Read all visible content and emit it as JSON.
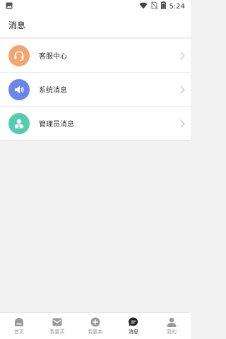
{
  "status_bar": {
    "time": "5:24"
  },
  "header": {
    "title": "消息"
  },
  "list": {
    "items": [
      {
        "label": "客服中心",
        "icon": "headset-icon",
        "color": "#f2a66e"
      },
      {
        "label": "系统消息",
        "icon": "speaker-icon",
        "color": "#6a86ee"
      },
      {
        "label": "管理员消息",
        "icon": "admin-user-icon",
        "color": "#54ccb0"
      }
    ]
  },
  "tabbar": {
    "tabs": [
      {
        "label": "首页",
        "icon": "home-icon",
        "active": false
      },
      {
        "label": "我要买",
        "icon": "mail-icon",
        "active": false
      },
      {
        "label": "我要卖",
        "icon": "plus-circle-icon",
        "active": false
      },
      {
        "label": "消息",
        "icon": "message-icon",
        "active": true
      },
      {
        "label": "我的",
        "icon": "person-icon",
        "active": false
      }
    ]
  },
  "colors": {
    "active_tab": "#222222",
    "inactive_tab": "#9a9a9a",
    "background": "#f2f2f2"
  }
}
